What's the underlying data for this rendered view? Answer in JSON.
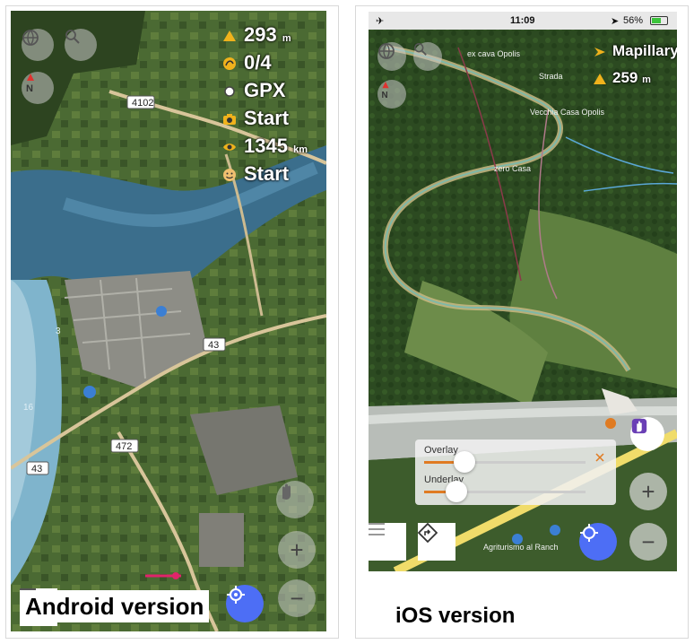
{
  "android": {
    "stats": [
      {
        "icon": "altitude-triangle-icon",
        "value": "293",
        "unit": "m"
      },
      {
        "icon": "tracks-icon",
        "value": "0/4",
        "unit": ""
      },
      {
        "icon": "gpx-dot-icon",
        "value": "GPX",
        "unit": ""
      },
      {
        "icon": "camera-icon",
        "value": "Start",
        "unit": ""
      },
      {
        "icon": "eye-icon",
        "value": "1345",
        "unit": "km"
      },
      {
        "icon": "smiley-icon",
        "value": "Start",
        "unit": ""
      }
    ],
    "map_labels": {
      "road_4102": "4102",
      "road_43_a": "43",
      "road_472": "472",
      "road_43_b": "43",
      "depth_16": "16",
      "depth_3": "3"
    },
    "caption": "Android version",
    "colors": {
      "locate": "#4d6ef5",
      "knob": "#e07b22"
    }
  },
  "ios": {
    "statusbar": {
      "time": "11:09",
      "battery": "56%"
    },
    "layer_name": "Mapillary",
    "altitude": {
      "value": "259",
      "unit": "m"
    },
    "map_labels": {
      "top": "ex cava Opolis",
      "strada": "Strada",
      "vecchia": "Vecchia Casa Opolis",
      "zero": "zero Casa",
      "agri": "Agriturismo al Ranch"
    },
    "sliders": [
      {
        "label": "Overlay",
        "value": 0.25
      },
      {
        "label": "Underlay",
        "value": 0.2
      }
    ],
    "caption": "iOS version",
    "colors": {
      "locate": "#4d6ef5",
      "accent": "#e07b22",
      "touch": "#6a3fb5"
    }
  }
}
